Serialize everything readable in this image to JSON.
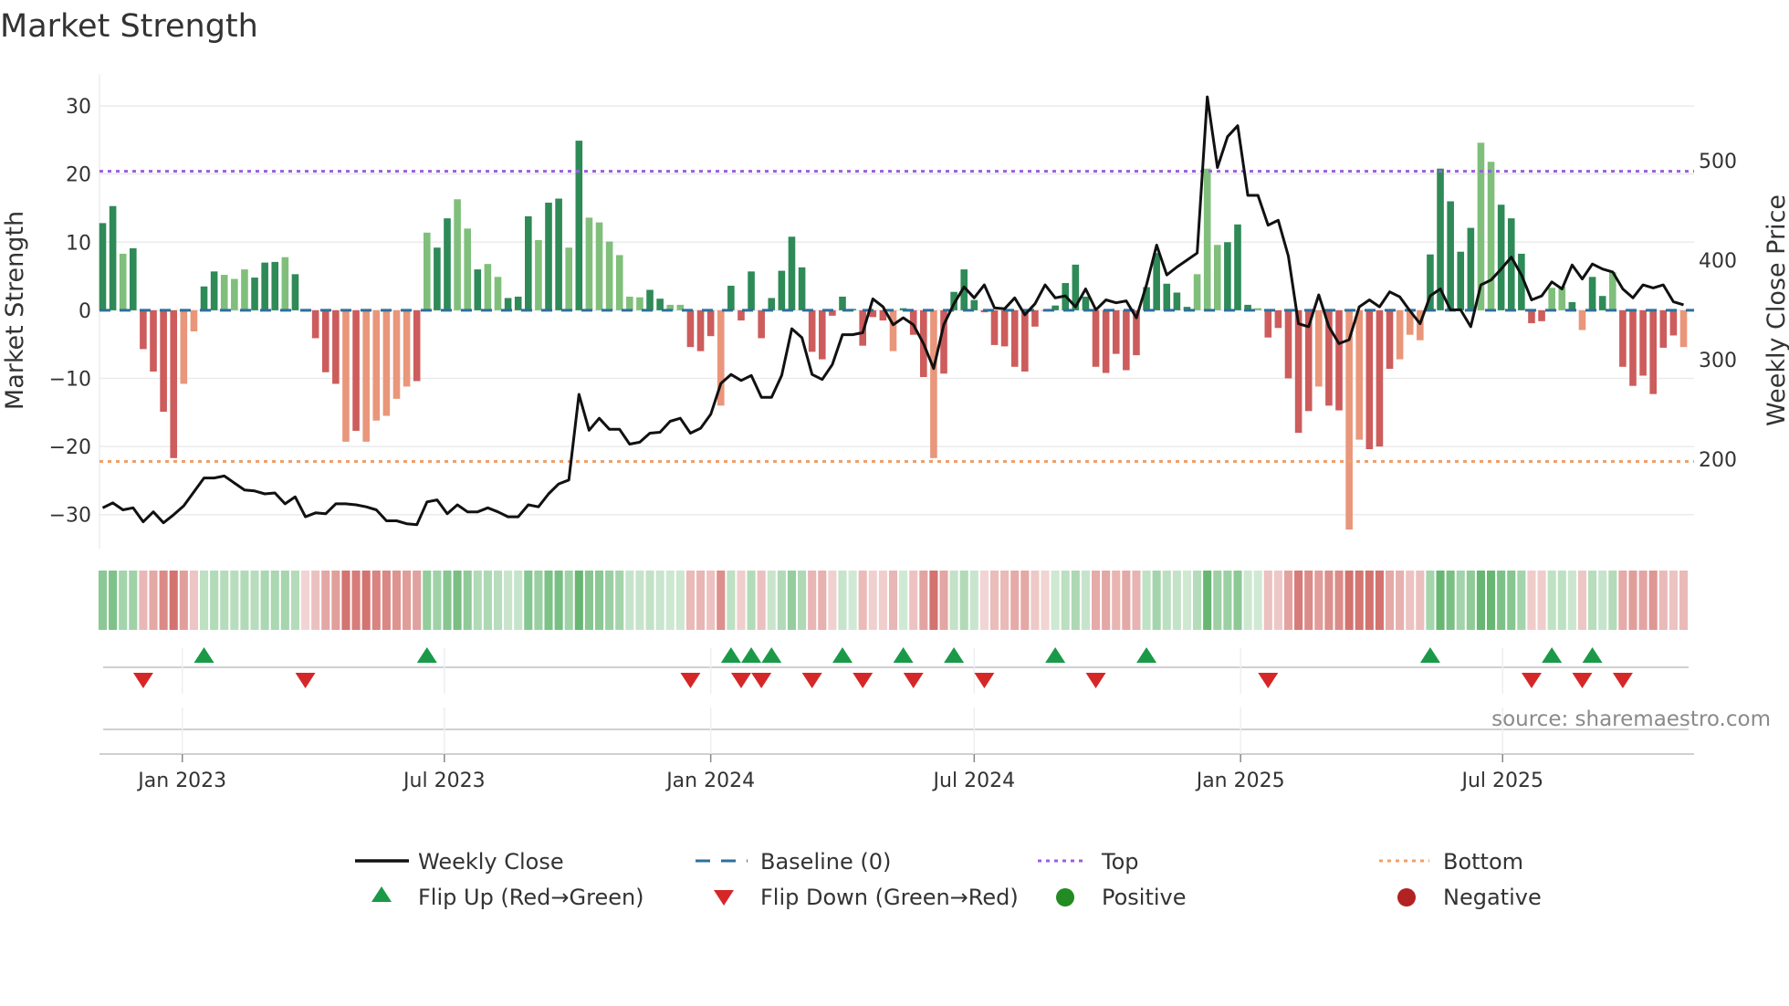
{
  "chart_data": {
    "type": "bar",
    "title": "Market Strength",
    "ylabel": "Market Strength",
    "y2label": "Weekly Close Price",
    "ylim": [
      -35,
      34.7
    ],
    "y2lim": [
      110,
      587
    ],
    "yticks": [
      "30",
      "20",
      "10",
      "0",
      "−10",
      "−20",
      "−30"
    ],
    "ytick_values": [
      30,
      20,
      10,
      0,
      -10,
      -20,
      -30
    ],
    "y2ticks": [
      "500",
      "400",
      "300",
      "200"
    ],
    "y2tick_values": [
      500,
      400,
      300,
      200
    ],
    "x_start": "2022-11-07",
    "x_step_days": 7,
    "xticks": [
      {
        "label": "Jan 2023",
        "date": "2023-01-01"
      },
      {
        "label": "Jul 2023",
        "date": "2023-07-01"
      },
      {
        "label": "Jan 2024",
        "date": "2024-01-01"
      },
      {
        "label": "Jul 2024",
        "date": "2024-07-01"
      },
      {
        "label": "Jan 2025",
        "date": "2025-01-01"
      },
      {
        "label": "Jul 2025",
        "date": "2025-07-01"
      }
    ],
    "top_level": 20.4,
    "bottom_level": -22.2,
    "baseline": 0,
    "strength": [
      12.8,
      15.3,
      8.3,
      9.1,
      -5.7,
      -9,
      -14.9,
      -21.7,
      -10.8,
      -3.1,
      3.5,
      5.7,
      5.2,
      4.6,
      6,
      4.8,
      7,
      7.1,
      7.8,
      5.3,
      -0.2,
      -4.1,
      -9.1,
      -10.8,
      -19.3,
      -17.7,
      -19.3,
      -16.2,
      -15.5,
      -13,
      -11.2,
      -10.4,
      11.4,
      9.2,
      13.5,
      16.3,
      12,
      6,
      6.8,
      4.9,
      1.8,
      2,
      13.8,
      10.3,
      15.8,
      16.4,
      9.2,
      24.9,
      13.6,
      12.9,
      10.1,
      8.1,
      2,
      1.9,
      3,
      1.7,
      0.8,
      0.8,
      -5.4,
      -6,
      -3.8,
      -14,
      3.6,
      -1.5,
      5.7,
      -4.1,
      1.8,
      5.8,
      10.8,
      6.3,
      -6.1,
      -7.2,
      -0.8,
      2,
      0.2,
      -5.2,
      -1,
      -1.5,
      -6,
      0.3,
      -3.6,
      -9.8,
      -21.7,
      -9.3,
      2.7,
      6,
      1.5,
      -0.3,
      -5.1,
      -5.3,
      -8.3,
      -9,
      -2.4,
      -0.1,
      0.7,
      4,
      6.7,
      2,
      -8.3,
      -9.2,
      -6.4,
      -8.8,
      -6.6,
      3.4,
      8.4,
      3.9,
      2.6,
      0.5,
      5.3,
      20.8,
      9.6,
      10,
      12.6,
      0.8,
      0.3,
      -4,
      -2.6,
      -10,
      -18,
      -14.8,
      -11.2,
      -14,
      -14.7,
      -32.2,
      -19,
      -20.4,
      -20,
      -8.6,
      -7.2,
      -3.6,
      -4.4,
      8.2,
      20.8,
      16,
      8.6,
      12.1,
      24.6,
      21.8,
      15.5,
      13.5,
      8.3,
      -1.9,
      -1.6,
      3.3,
      3.5,
      1.2,
      -2.9,
      4.9,
      2.1,
      5.6,
      -8.3,
      -11.1,
      -9.6,
      -12.3,
      -5.5,
      -3.7,
      -5.4
    ],
    "shade": "ddldrrrrssddllldddlsrrrrsrsssssdlddlldlldddlddldllllllddlldrrsrdrdrddddlrrsdlrssrdsrrsdd lrrrrrssddddlrrsrsddllldddlldllrsrrssrrrsssssrddlldddllllrsddlrdldrrsrssr",
    "close": [
      151,
      156,
      149,
      151,
      137,
      147,
      136,
      144,
      153,
      167,
      181,
      181,
      183,
      176,
      169,
      168,
      165,
      166,
      155,
      162,
      142,
      146,
      145,
      155,
      155,
      154,
      152,
      149,
      138,
      138,
      135,
      134,
      157,
      159,
      145,
      154,
      147,
      147,
      151,
      147,
      142,
      142,
      154,
      152,
      165,
      175,
      179,
      265,
      229,
      241,
      230,
      230,
      215,
      217,
      226,
      227,
      238,
      241,
      226,
      231,
      245,
      276,
      285,
      279,
      284,
      262,
      262,
      284,
      331,
      322,
      285,
      280,
      295,
      325,
      325,
      327,
      361,
      353,
      335,
      342,
      335,
      316,
      291,
      335,
      356,
      373,
      362,
      375,
      352,
      351,
      362,
      345,
      356,
      375,
      362,
      364,
      353,
      371,
      350,
      360,
      357,
      359,
      342,
      375,
      415,
      385,
      393,
      400,
      407,
      564,
      493,
      524,
      535,
      465,
      465,
      435,
      440,
      404,
      336,
      333,
      365,
      333,
      316,
      320,
      353,
      360,
      353,
      368,
      363,
      349,
      336,
      364,
      371,
      350,
      350,
      333,
      375,
      380,
      391,
      403,
      385,
      360,
      364,
      378,
      371,
      395,
      381,
      396,
      391,
      388,
      371,
      362,
      375,
      372,
      375,
      358,
      355
    ],
    "flip_up": [
      10,
      32,
      62,
      64,
      66,
      73,
      79,
      84,
      94,
      103,
      131,
      143,
      147
    ],
    "flip_down": [
      4,
      20,
      58,
      63,
      65,
      70,
      75,
      80,
      87,
      98,
      115,
      141,
      146,
      150
    ],
    "legend": {
      "placement": "bottom",
      "items": [
        "Weekly Close",
        "Baseline (0)",
        "Top",
        "Bottom",
        "Flip Up (Red→Green)",
        "Flip Down (Green→Red)",
        "Positive",
        "Negative"
      ]
    },
    "source": "source: sharemaestro.com"
  },
  "colors": {
    "pos_strong": "#2e8a57",
    "pos_weak": "#7fbf7b",
    "neg_strong": "#cd5c5c",
    "neg_weak": "#e9967a",
    "line": "#111111",
    "baseline": "#2f6f9a",
    "top": "#9b5fe0",
    "bottom": "#f0a068",
    "flip_up": "#1a9a48",
    "flip_down": "#d62728",
    "positive": "#228b22",
    "negative": "#b22222",
    "grid": "#ebebeb"
  }
}
